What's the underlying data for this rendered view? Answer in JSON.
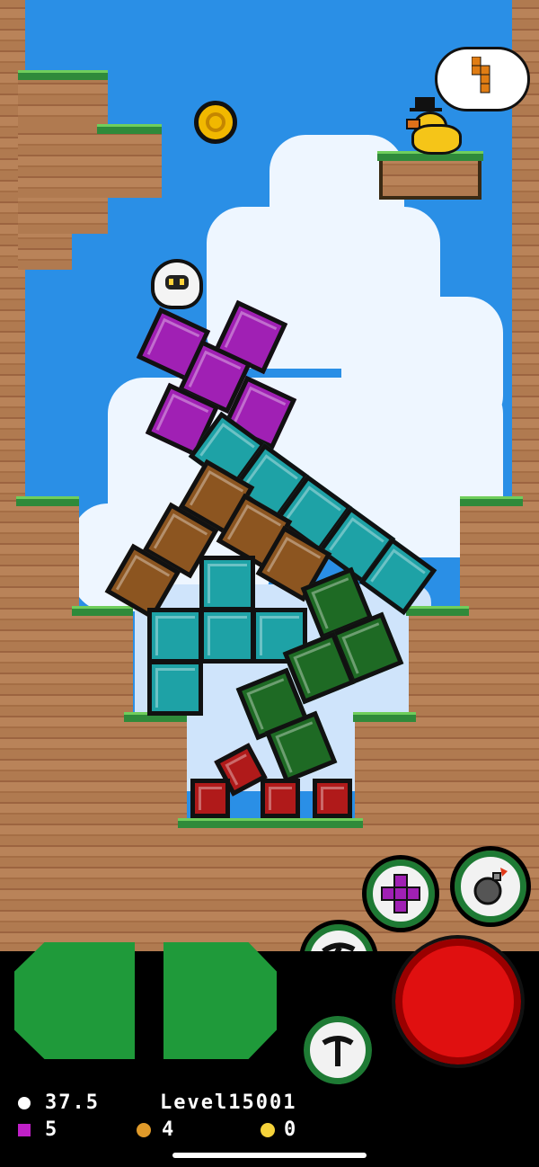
{
  "hud": {
    "timer": "37.5",
    "level": "Level15001",
    "blocks_count": "5",
    "bombs_count": "4",
    "coins_count": "0"
  },
  "colors": {
    "sky": "#2a8fe6",
    "purple_block": "#a020b4",
    "teal_block": "#1ea2a6",
    "brown_block": "#8c5520",
    "green_block": "#1e6a24",
    "red_block": "#b01a1a",
    "move_button": "#1f9a3a",
    "drop_button": "#e01010"
  },
  "icons": {
    "timer": "clock-icon",
    "blocks": "block-icon",
    "bombs": "bomb-icon",
    "coins": "coin-icon",
    "next_piece": "tetromino-icon"
  }
}
